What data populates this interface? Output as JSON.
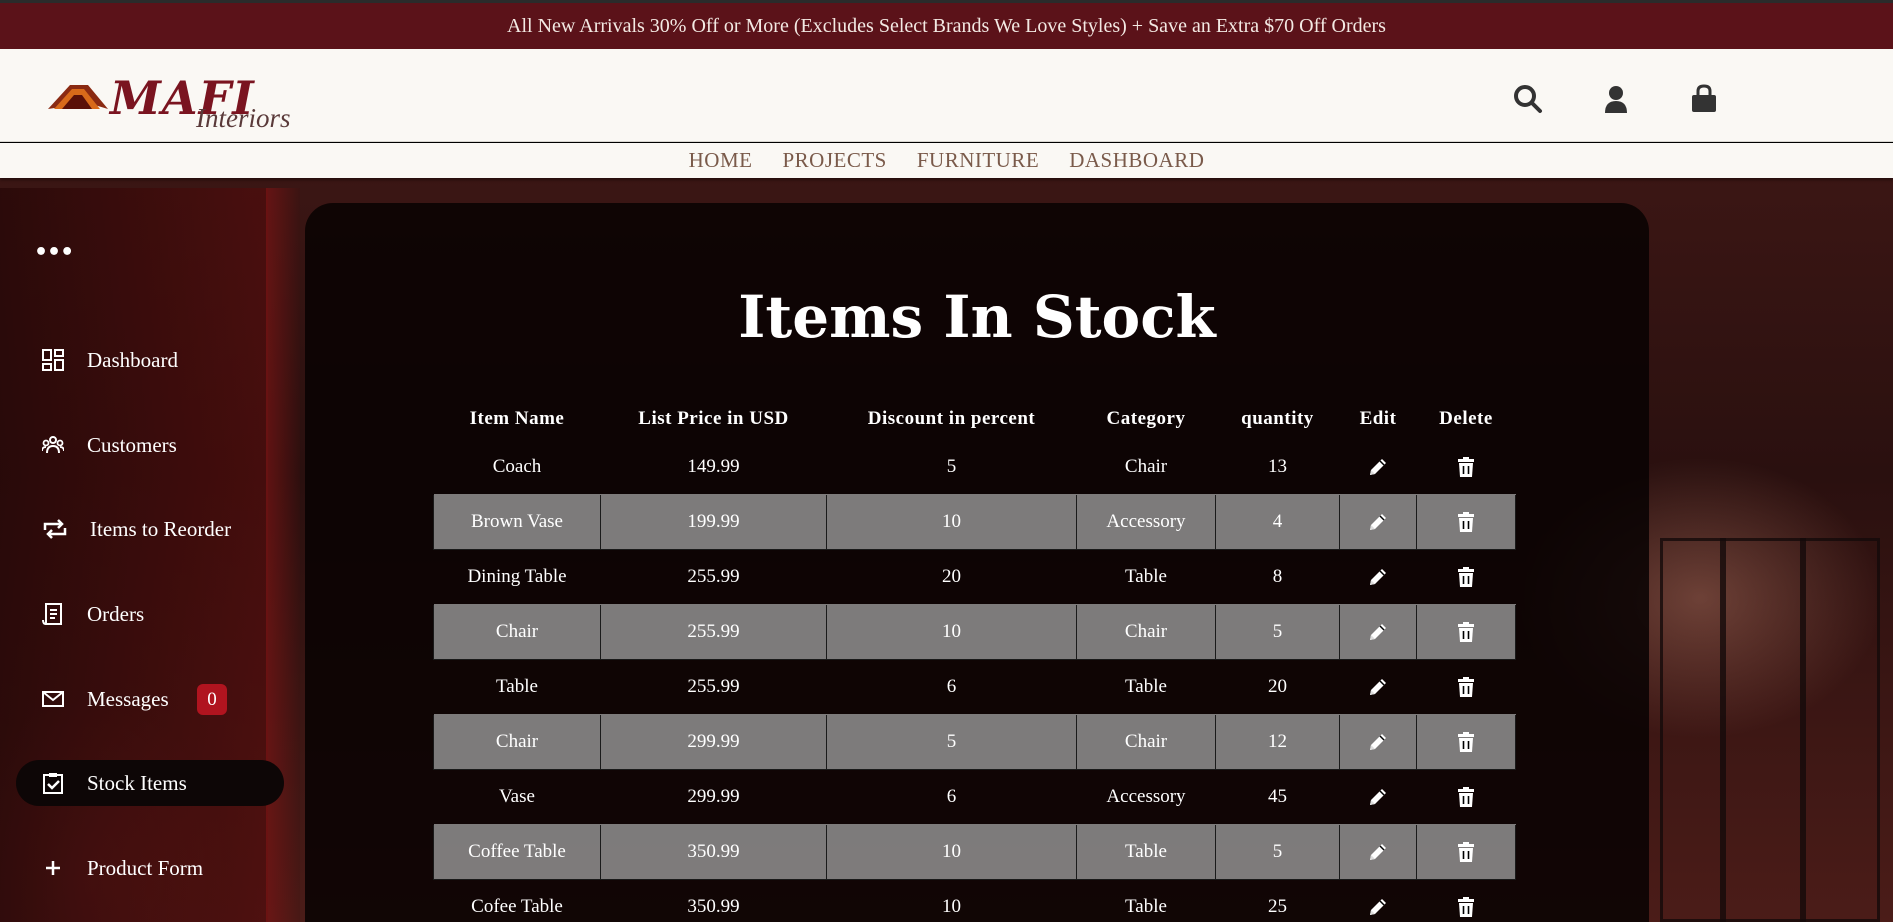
{
  "promo": {
    "text": "All New Arrivals 30% Off or More (Excludes Select Brands We Love Styles) + Save an Extra $70 Off Orders"
  },
  "brand": {
    "name": "MAFI",
    "sub": "Interiors"
  },
  "header_icons": [
    "search-icon",
    "user-icon",
    "shopping-bag-icon"
  ],
  "nav": {
    "items": [
      "HOME",
      "PROJECTS",
      "FURNITURE",
      "DASHBOARD"
    ]
  },
  "sidebar": {
    "menu_dots": "•••",
    "items": [
      {
        "label": "Dashboard",
        "icon": "dashboard-icon"
      },
      {
        "label": "Customers",
        "icon": "customers-icon"
      },
      {
        "label": "Items to Reorder",
        "icon": "reorder-icon"
      },
      {
        "label": "Orders",
        "icon": "orders-icon"
      },
      {
        "label": "Messages",
        "icon": "mail-icon",
        "badge": "0"
      },
      {
        "label": "Stock Items",
        "icon": "clipboard-check-icon",
        "active": true
      },
      {
        "label": "Product Form",
        "icon": "plus-icon"
      }
    ]
  },
  "main": {
    "title": "Items In Stock",
    "table": {
      "columns": [
        "Item Name",
        "List Price in USD",
        "Discount in percent",
        "Category",
        "quantity",
        "Edit",
        "Delete"
      ],
      "rows": [
        [
          "Coach",
          "149.99",
          "5",
          "Chair",
          "13"
        ],
        [
          "Brown Vase",
          "199.99",
          "10",
          "Accessory",
          "4"
        ],
        [
          "Dining Table",
          "255.99",
          "20",
          "Table",
          "8"
        ],
        [
          "Chair",
          "255.99",
          "10",
          "Chair",
          "5"
        ],
        [
          "Table",
          "255.99",
          "6",
          "Table",
          "20"
        ],
        [
          "Chair",
          "299.99",
          "5",
          "Chair",
          "12"
        ],
        [
          "Vase",
          "299.99",
          "6",
          "Accessory",
          "45"
        ],
        [
          "Coffee Table",
          "350.99",
          "10",
          "Table",
          "5"
        ],
        [
          "Cofee Table",
          "350.99",
          "10",
          "Table",
          "25"
        ]
      ]
    }
  },
  "colors": {
    "promo_bg": "#5b1219",
    "accent": "#b0141f",
    "nav_text": "#7a5a4a"
  }
}
